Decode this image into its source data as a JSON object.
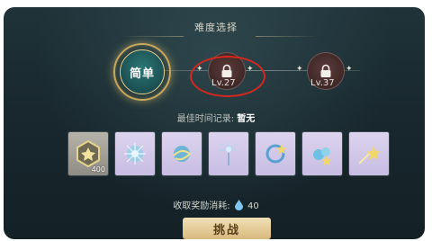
{
  "header": {
    "title": "难度选择"
  },
  "difficulties": [
    {
      "label": "简单",
      "state": "selected"
    },
    {
      "label": "Lv.27",
      "state": "locked",
      "icon": "lock-icon",
      "highlight_color": "#d6271f"
    },
    {
      "label": "Lv.37",
      "state": "locked",
      "icon": "lock-icon"
    }
  ],
  "record": {
    "label": "最佳时间记录:",
    "value": "暂无"
  },
  "rewards": [
    {
      "icon": "gold-emblem-icon",
      "count": "400"
    },
    {
      "icon": "blue-flower-icon"
    },
    {
      "icon": "swirl-orb-icon"
    },
    {
      "icon": "dandelion-icon"
    },
    {
      "icon": "star-wreath-icon"
    },
    {
      "icon": "star-cluster-icon"
    },
    {
      "icon": "shooting-star-icon"
    }
  ],
  "cost": {
    "label": "收取奖励消耗:",
    "value": "40",
    "icon": "resin-drop-icon"
  },
  "action": {
    "label": "挑战"
  },
  "colors": {
    "accent_gold": "#c9a85a",
    "selected_teal": "#1b4f52",
    "locked_brown": "#3c2626",
    "button": "#e7cd95"
  }
}
